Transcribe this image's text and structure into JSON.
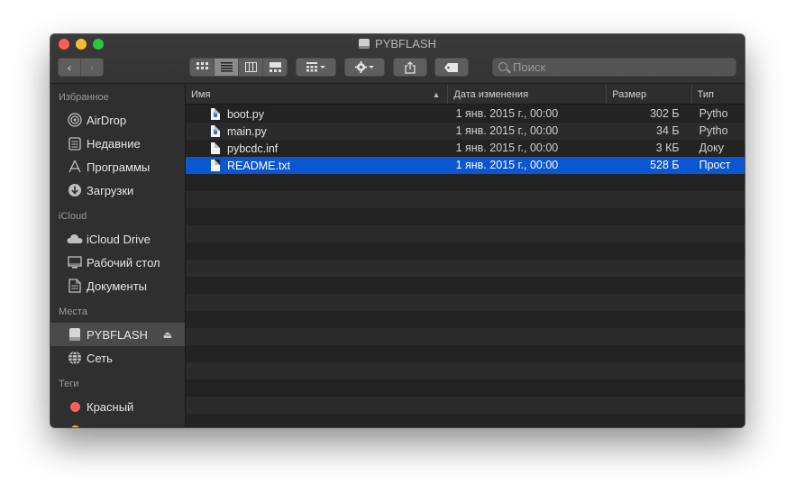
{
  "window": {
    "title": "PYBFLASH"
  },
  "toolbar": {
    "back_label": "‹",
    "forward_label": "›",
    "search_placeholder": "Поиск"
  },
  "sidebar": {
    "sections": [
      {
        "header": "Избранное",
        "items": [
          {
            "label": "AirDrop",
            "icon": "airdrop-icon"
          },
          {
            "label": "Недавние",
            "icon": "recents-icon"
          },
          {
            "label": "Программы",
            "icon": "applications-icon"
          },
          {
            "label": "Загрузки",
            "icon": "downloads-icon"
          }
        ]
      },
      {
        "header": "iCloud",
        "items": [
          {
            "label": "iCloud Drive",
            "icon": "cloud-icon"
          },
          {
            "label": "Рабочий стол",
            "icon": "desktop-icon"
          },
          {
            "label": "Документы",
            "icon": "documents-icon"
          }
        ]
      },
      {
        "header": "Места",
        "items": [
          {
            "label": "PYBFLASH",
            "icon": "drive-icon",
            "selected": true
          },
          {
            "label": "Сеть",
            "icon": "network-icon"
          }
        ]
      },
      {
        "header": "Теги",
        "items": [
          {
            "label": "Красный",
            "color": "#fc5f57"
          }
        ]
      }
    ]
  },
  "columns": {
    "name": "Имя",
    "date": "Дата изменения",
    "size": "Размер",
    "type": "Тип"
  },
  "files": [
    {
      "name": "boot.py",
      "date": "1 янв. 2015 г., 00:00",
      "size": "302 Б",
      "type": "Pytho",
      "kind": "py"
    },
    {
      "name": "main.py",
      "date": "1 янв. 2015 г., 00:00",
      "size": "34 Б",
      "type": "Pytho",
      "kind": "py"
    },
    {
      "name": "pybcdc.inf",
      "date": "1 янв. 2015 г., 00:00",
      "size": "3 КБ",
      "type": "Доку",
      "kind": "doc"
    },
    {
      "name": "README.txt",
      "date": "1 янв. 2015 г., 00:00",
      "size": "528 Б",
      "type": "Прост",
      "kind": "txt",
      "selected": true
    }
  ],
  "colors": {
    "selection": "#0b56d1",
    "window_bg": "#2a2a2a"
  }
}
